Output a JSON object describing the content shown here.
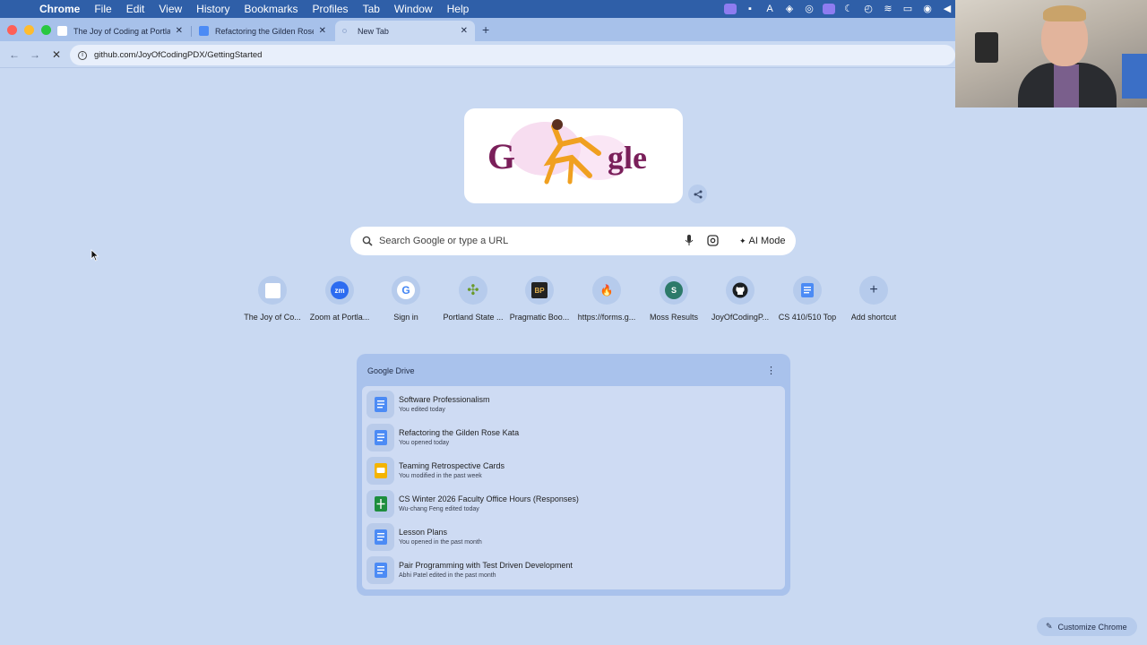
{
  "menubar": {
    "app": "Chrome",
    "items": [
      "File",
      "Edit",
      "View",
      "History",
      "Bookmarks",
      "Profiles",
      "Tab",
      "Window",
      "Help"
    ]
  },
  "tabs": [
    {
      "title": "The Joy of Coding at Portland",
      "favicon": "blank-page-icon",
      "active": false
    },
    {
      "title": "Refactoring the Gilden Rose",
      "favicon": "google-docs-icon",
      "active": false
    },
    {
      "title": "New Tab",
      "favicon": "loading-icon",
      "active": true
    }
  ],
  "toolbar": {
    "url": "github.com/JoyOfCodingPDX/GettingStarted"
  },
  "search": {
    "placeholder": "Search Google or type a URL",
    "ai_mode_label": "AI Mode"
  },
  "doodle": {
    "text": [
      "G",
      "gle"
    ]
  },
  "shortcuts": [
    {
      "label": "The Joy of Co...",
      "icon": "blank-page-icon",
      "glyph": ""
    },
    {
      "label": "Zoom at Portla...",
      "icon": "zoom-icon",
      "glyph": "zm"
    },
    {
      "label": "Sign in",
      "icon": "google-icon",
      "glyph": "G"
    },
    {
      "label": "Portland State ...",
      "icon": "portland-state-icon",
      "glyph": "✣"
    },
    {
      "label": "Pragmatic Boo...",
      "icon": "pragmatic-bookshelf-icon",
      "glyph": "BP"
    },
    {
      "label": "https://forms.g...",
      "icon": "forms-icon",
      "glyph": "🔥"
    },
    {
      "label": "Moss Results",
      "icon": "moss-icon",
      "glyph": "S"
    },
    {
      "label": "JoyOfCodingP...",
      "icon": "github-icon",
      "glyph": ""
    },
    {
      "label": "CS 410/510 Top",
      "icon": "google-docs-icon",
      "glyph": ""
    },
    {
      "label": "Add shortcut",
      "icon": "plus-icon",
      "glyph": "+"
    }
  ],
  "drive": {
    "title": "Google Drive",
    "items": [
      {
        "title": "Software Professionalism",
        "subtitle": "You edited today",
        "type": "docs"
      },
      {
        "title": "Refactoring the Gilden Rose Kata",
        "subtitle": "You opened today",
        "type": "docs"
      },
      {
        "title": "Teaming Retrospective Cards",
        "subtitle": "You modified in the past week",
        "type": "slides"
      },
      {
        "title": "CS Winter 2026 Faculty Office Hours (Responses)",
        "subtitle": "Wu-chang Feng edited today",
        "type": "sheets"
      },
      {
        "title": "Lesson Plans",
        "subtitle": "You opened in the past month",
        "type": "docs"
      },
      {
        "title": "Pair Programming with Test Driven Development",
        "subtitle": "Abhi Patel edited in the past month",
        "type": "docs"
      }
    ]
  },
  "customize_label": "Customize Chrome",
  "colors": {
    "page_bg": "#c9d9f2",
    "menubar_bg": "#2f5fa8",
    "tabstrip_bg": "#a7c1ea",
    "docs_blue": "#4c8bf5",
    "slides_yellow": "#f4b400",
    "sheets_green": "#1e8e3e"
  }
}
